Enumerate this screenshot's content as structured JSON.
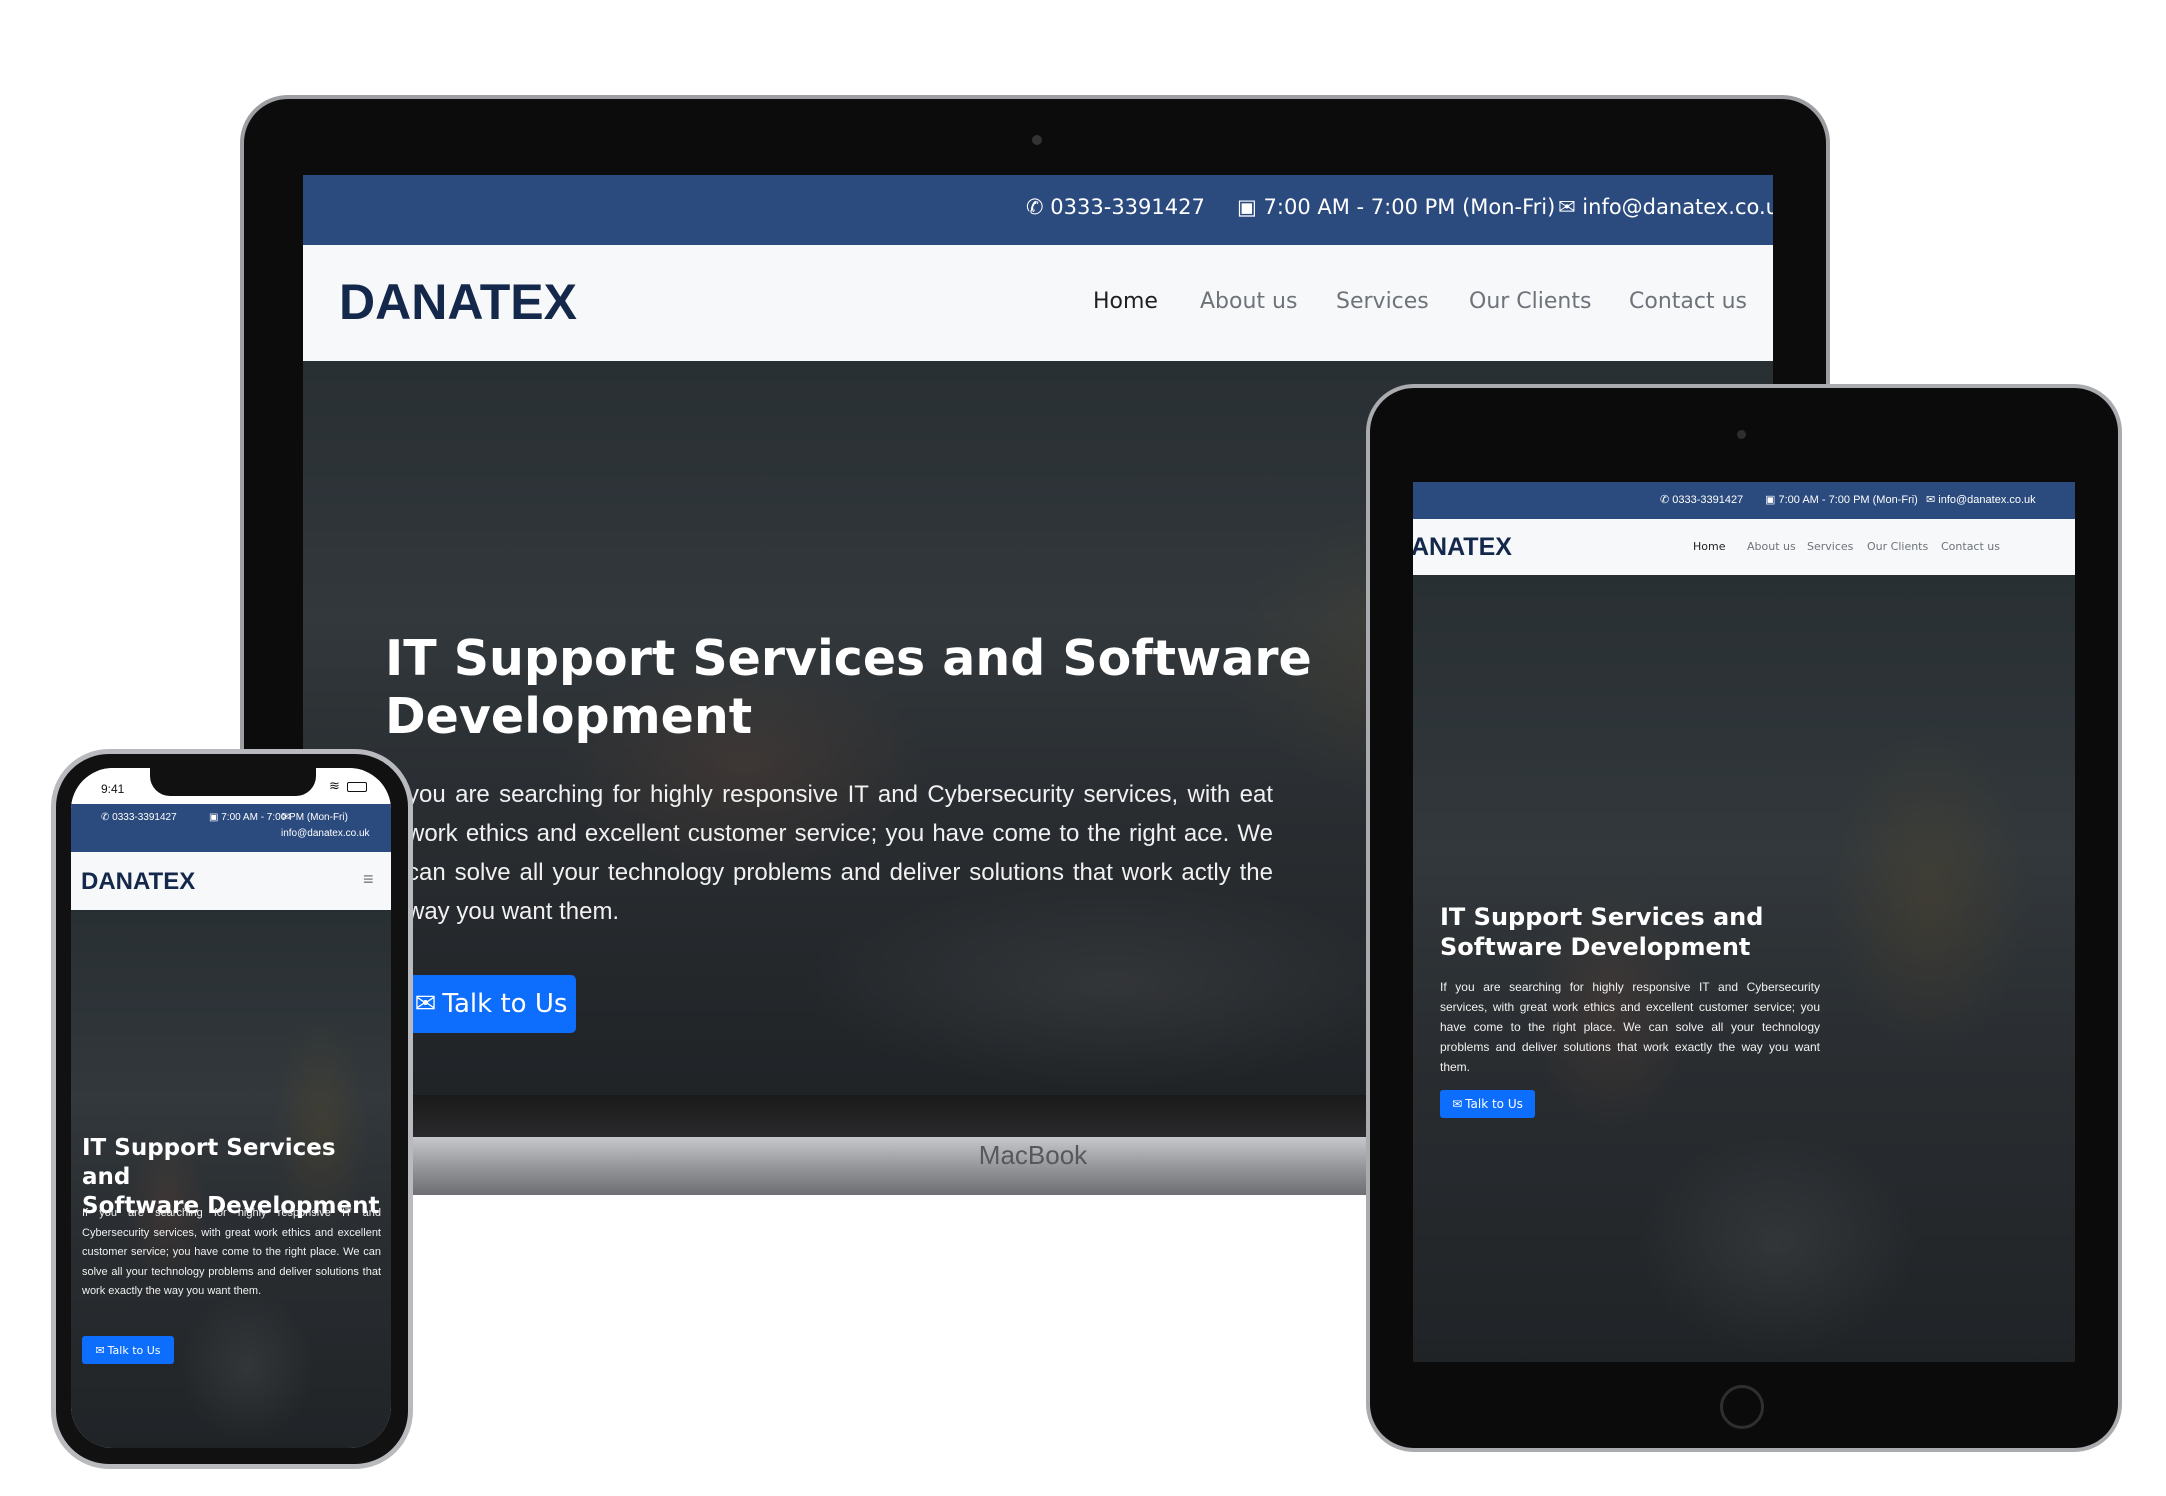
{
  "site": {
    "brand": "DANATEX",
    "contact": {
      "phone": "0333-3391427",
      "hours": "7:00 AM - 7:00 PM (Mon-Fri)",
      "email": "info@danatex.co.uk"
    },
    "nav": [
      "Home",
      "About us",
      "Services",
      "Our Clients",
      "Contact us"
    ],
    "hero": {
      "title_line1": "IT Support Services and Software",
      "title_line2": "Development",
      "title_phone_line1": "IT Support Services and",
      "title_phone_line2": "Software Development",
      "paragraph": "If you are searching for highly responsive IT and Cybersecurity services, with great work ethics and excellent customer service; you have come to the right place. We can solve all your technology problems and deliver solutions that work exactly the way you want them.",
      "cta": "Talk to Us"
    }
  },
  "laptop": {
    "label": "MacBook",
    "hero_paragraph_visible": "you are searching for highly responsive IT and Cybersecurity services, with eat work ethics and excellent customer service; you have come to the right ace. We can solve all your technology problems and deliver solutions that work actly the way you want them.",
    "tablet_brand_visible": "ANATEX"
  },
  "phone": {
    "status_time": "9:41"
  },
  "colors": {
    "topbar": "#2b4a7e",
    "brand": "#14284b",
    "cta": "#0d6efd"
  },
  "icons": [
    "phone-icon",
    "calendar-icon",
    "envelope-icon",
    "menu-icon",
    "wifi-icon",
    "battery-icon"
  ]
}
